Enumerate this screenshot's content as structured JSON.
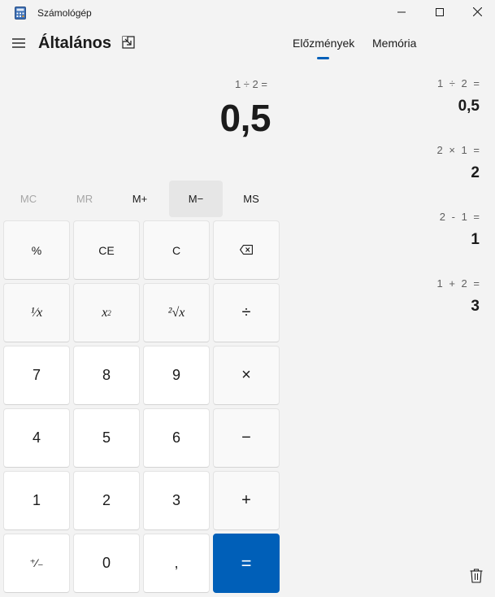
{
  "window": {
    "title": "Számológép",
    "icon": "calculator-icon",
    "controls": [
      "minimize-icon",
      "maximize-icon",
      "close-icon"
    ]
  },
  "header": {
    "menu_icon": "hamburger-icon",
    "mode": "Általános",
    "keep_on_top_icon": "keep-on-top-icon"
  },
  "tabs": [
    {
      "label": "Előzmények",
      "selected": true
    },
    {
      "label": "Memória",
      "selected": false
    }
  ],
  "display": {
    "expression": "1 ÷ 2 =",
    "result": "0,5"
  },
  "memory": {
    "mc": "MC",
    "mr": "MR",
    "mplus": "M+",
    "mminus": "M−",
    "ms": "MS"
  },
  "keys": {
    "percent": "%",
    "ce": "CE",
    "c": "C",
    "backspace_icon": "backspace-icon",
    "reciprocal": "¹⁄x",
    "square_base": "x",
    "square_exp": "2",
    "sqrt": "²√x",
    "divide": "÷",
    "seven": "7",
    "eight": "8",
    "nine": "9",
    "multiply": "×",
    "four": "4",
    "five": "5",
    "six": "6",
    "minus": "−",
    "one": "1",
    "two": "2",
    "three": "3",
    "plus": "+",
    "negate": "⁺⁄₋",
    "zero": "0",
    "decimal": ",",
    "equals": "="
  },
  "history": [
    {
      "expression": "1 ÷ 2 =",
      "result": "0,5"
    },
    {
      "expression": "2 × 1 =",
      "result": "2"
    },
    {
      "expression": "2 - 1 =",
      "result": "1"
    },
    {
      "expression": "1 + 2 =",
      "result": "3"
    }
  ],
  "history_clear_icon": "trash-icon",
  "colors": {
    "accent": "#005fb8",
    "background": "#f3f3f3",
    "number_key": "#ffffff",
    "function_key": "#f9f9f9"
  }
}
